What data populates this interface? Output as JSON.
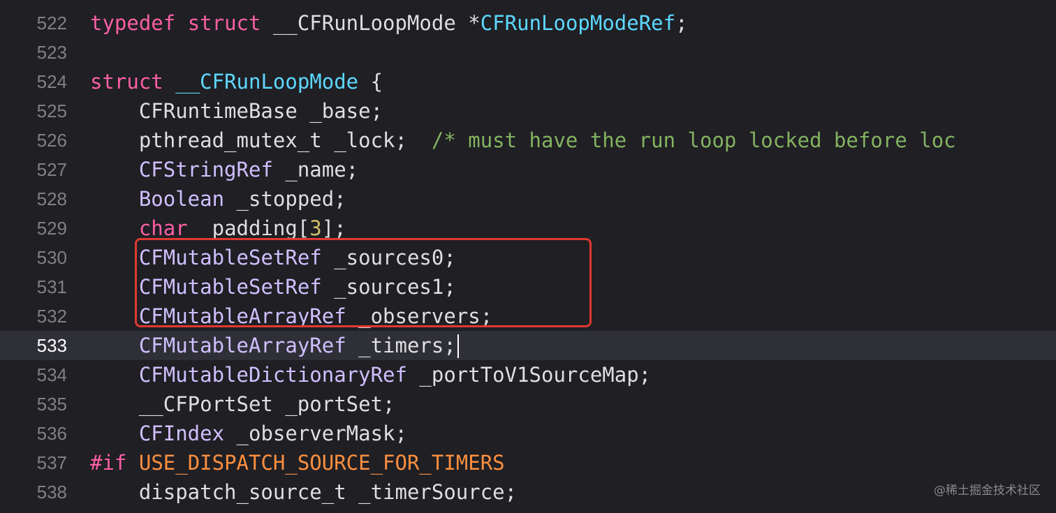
{
  "editor": {
    "colors": {
      "background": "#1f1f24",
      "current_line": "#2f3037",
      "keyword": "#fc5fa3",
      "type_declaration": "#5dd8ff",
      "type": "#d0bfff",
      "plain": "#dfdfe0",
      "comment": "#84b360",
      "number": "#d0bf69",
      "preprocessor": "#fd8f3f",
      "highlight_box": "#e03a2f"
    },
    "current_line_number": "533",
    "lines": [
      {
        "number": "522",
        "tokens": [
          "typedef",
          " ",
          "struct",
          " __CFRunLoopMode *",
          "CFRunLoopModeRef",
          ";"
        ]
      },
      {
        "number": "523",
        "tokens": []
      },
      {
        "number": "524",
        "tokens": [
          "struct",
          " ",
          "__CFRunLoopMode",
          " {"
        ]
      },
      {
        "number": "525",
        "tokens": [
          "    CFRuntimeBase _base;"
        ]
      },
      {
        "number": "526",
        "tokens": [
          "    pthread_mutex_t _lock;  ",
          "/* must have the run loop locked before loc"
        ]
      },
      {
        "number": "527",
        "tokens": [
          "    ",
          "CFStringRef",
          " _name;"
        ]
      },
      {
        "number": "528",
        "tokens": [
          "    ",
          "Boolean",
          " _stopped;"
        ]
      },
      {
        "number": "529",
        "tokens": [
          "    ",
          "char",
          " _padding[",
          "3",
          "];"
        ]
      },
      {
        "number": "530",
        "tokens": [
          "    ",
          "CFMutableSetRef",
          " _sources0;"
        ]
      },
      {
        "number": "531",
        "tokens": [
          "    ",
          "CFMutableSetRef",
          " _sources1;"
        ]
      },
      {
        "number": "532",
        "tokens": [
          "    ",
          "CFMutableArrayRef",
          " _observers;"
        ]
      },
      {
        "number": "533",
        "tokens": [
          "    ",
          "CFMutableArrayRef",
          " _timers;"
        ]
      },
      {
        "number": "534",
        "tokens": [
          "    ",
          "CFMutableDictionaryRef",
          " _portToV1SourceMap;"
        ]
      },
      {
        "number": "535",
        "tokens": [
          "    __CFPortSet _portSet;"
        ]
      },
      {
        "number": "536",
        "tokens": [
          "    ",
          "CFIndex",
          " _observerMask;"
        ]
      },
      {
        "number": "537",
        "tokens": [
          "#if",
          " ",
          "USE_DISPATCH_SOURCE_FOR_TIMERS"
        ]
      },
      {
        "number": "538",
        "tokens": [
          "    dispatch_source_t _timerSource;"
        ]
      }
    ]
  },
  "watermark": "@稀土掘金技术社区"
}
